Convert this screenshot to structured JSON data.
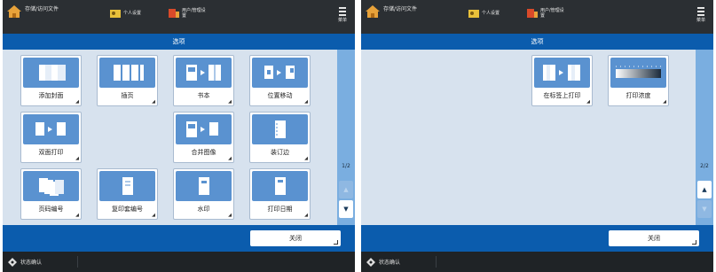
{
  "colors": {
    "topbar": "#2b2f33",
    "accent_blue": "#0b5cad",
    "content_bg": "#d7e2ee",
    "tile_icon_bg": "#5a92d0",
    "scrollbar": "#7aaee0",
    "statusbar": "#1f2326"
  },
  "screens": [
    {
      "header": {
        "home_label": "存储/访问文件",
        "home_icon": "home-house-icon",
        "shortcut1_label": "个人设置",
        "shortcut1_icon": "personal-settings-icon",
        "shortcut2_label": "用户/管理设置",
        "shortcut2_icon": "admin-settings-icon",
        "menu_label": "菜单",
        "menu_icon": "menu-icon"
      },
      "title": "选项",
      "tiles": [
        {
          "label": "添加封面",
          "icon": "add-cover-icon"
        },
        {
          "label": "插页",
          "icon": "insert-sheets-icon"
        },
        {
          "label": "书本",
          "icon": "booklet-icon"
        },
        {
          "label": "位置移动",
          "icon": "shift-position-icon"
        },
        {
          "label": "双面打印",
          "icon": "two-sided-icon"
        },
        {
          "label": "合并图像",
          "icon": "merge-images-icon"
        },
        {
          "label": "装订边",
          "icon": "gutter-icon"
        },
        {
          "label": "页码编号",
          "icon": "page-numbering-icon"
        },
        {
          "label": "复印套编号",
          "icon": "copy-set-numbering-icon"
        },
        {
          "label": "水印",
          "icon": "watermark-icon"
        },
        {
          "label": "打印日期",
          "icon": "print-date-icon"
        }
      ],
      "page_indicator": "1/2",
      "close_label": "关闭",
      "status_label": "状态确认"
    },
    {
      "header": {
        "home_label": "存储/访问文件",
        "home_icon": "home-house-icon",
        "shortcut1_label": "个人设置",
        "shortcut1_icon": "personal-settings-icon",
        "shortcut2_label": "用户/管理设置",
        "shortcut2_icon": "admin-settings-icon",
        "menu_label": "菜单",
        "menu_icon": "menu-icon"
      },
      "title": "选项",
      "tiles": [
        {
          "label": "在标签上打印",
          "icon": "print-on-tab-icon"
        },
        {
          "label": "打印浓度",
          "icon": "print-density-icon"
        }
      ],
      "page_indicator": "2/2",
      "close_label": "关闭",
      "status_label": "状态确认"
    }
  ]
}
